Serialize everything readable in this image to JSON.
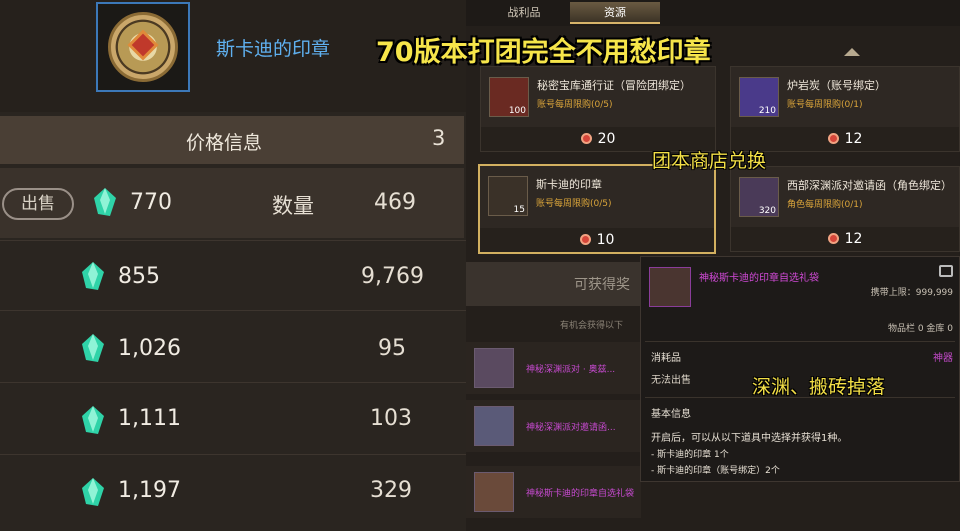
{
  "item": {
    "name": "斯卡迪的印章",
    "icon": "seal-icon"
  },
  "price_panel": {
    "title": "价格信息",
    "page_count": "3",
    "sell_label": "出售",
    "qty_label": "数量",
    "rows": [
      {
        "price": "770",
        "qty": "469"
      },
      {
        "price": "855",
        "qty": "9,769"
      },
      {
        "price": "1,026",
        "qty": "95"
      },
      {
        "price": "1,111",
        "qty": "103"
      },
      {
        "price": "1,197",
        "qty": "329"
      }
    ]
  },
  "shop": {
    "tabs": [
      "战利品",
      "资源"
    ],
    "active_tab": "资源",
    "cards": [
      {
        "name": "秘密宝库通行证（冒险团绑定）",
        "limit": "账号每周限购(0/5)",
        "count": "100",
        "cost": "20"
      },
      {
        "name": "炉岩炭（账号绑定）",
        "limit": "账号每周限购(0/1)",
        "count": "210",
        "cost": "12"
      },
      {
        "name": "斯卡迪的印章",
        "limit": "账号每周限购(0/5)",
        "count": "15",
        "cost": "10"
      },
      {
        "name": "西部深渊派对邀请函（角色绑定）",
        "limit": "角色每周限购(0/1)",
        "count": "320",
        "cost": "12"
      }
    ]
  },
  "obtain": {
    "title": "可获得奖",
    "subtitle": "有机会获得以下",
    "rows": [
      {
        "text": "神秘深渊派对 · 奥兹..."
      },
      {
        "text": "神秘深渊派对邀请函..."
      },
      {
        "text": "神秘斯卡迪的印章自选礼袋"
      }
    ]
  },
  "tooltip": {
    "name": "神秘斯卡迪的印章自选礼袋",
    "hold_limit": "携带上限：999,999",
    "slots": "物品栏 0 金库 0",
    "category": "消耗品",
    "rarity": "神器",
    "sell_status": "无法出售",
    "basic_title": "基本信息",
    "desc": "开启后，可以从以下道具中选择并获得1种。",
    "options": [
      "- 斯卡迪的印章 1个",
      "- 斯卡迪的印章（账号绑定）2个"
    ]
  },
  "captions": {
    "main": "70版本打团完全不用愁印章",
    "shop": "团本商店兑换",
    "drop": "深渊、搬砖掉落"
  },
  "colors": {
    "item_name": "#5fb0ef",
    "caption": "#f6e54a",
    "purple": "#d24ad8",
    "gold_border": "#d2b060"
  }
}
